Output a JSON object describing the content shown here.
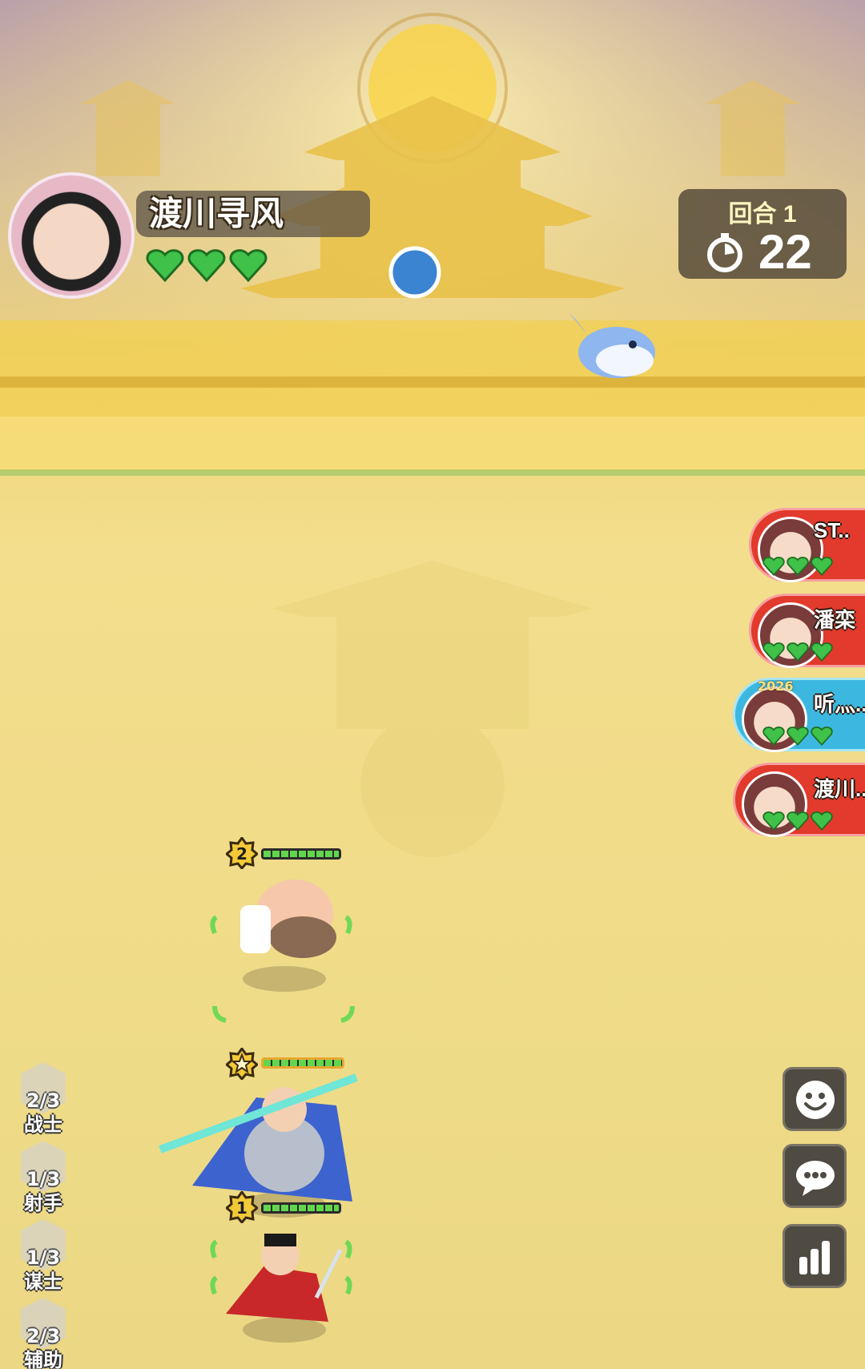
{
  "player": {
    "name": "渡川寻风",
    "lives": 3
  },
  "round": {
    "label": "回合 1",
    "timer": "22"
  },
  "opponents": [
    {
      "name": "ST..",
      "lives": 3,
      "style": "red"
    },
    {
      "name": "潘栾",
      "lives": 3,
      "style": "red"
    },
    {
      "name": "听灬..",
      "lives": 3,
      "style": "blue",
      "badge": "2026"
    },
    {
      "name": "渡川..",
      "lives": 3,
      "style": "red"
    }
  ],
  "units": [
    {
      "level": "2",
      "hp_fraction": 1.0
    },
    {
      "level": "",
      "hp_fraction": 1.0
    },
    {
      "level": "1",
      "hp_fraction": 1.0
    }
  ],
  "classes": [
    {
      "count": "2/3",
      "name": "战士"
    },
    {
      "count": "1/3",
      "name": "射手"
    },
    {
      "count": "1/3",
      "name": "谋士"
    },
    {
      "count": "2/3",
      "name": "辅助"
    }
  ],
  "buttons": {
    "emoji": "smiley-icon",
    "chat": "chat-bubble-icon",
    "stats": "bar-chart-icon"
  },
  "colors": {
    "heart": "#3fc14a",
    "opponent_red": "#e23a2c",
    "opponent_blue": "#3cb8e0",
    "hp_green": "#62d64c"
  }
}
